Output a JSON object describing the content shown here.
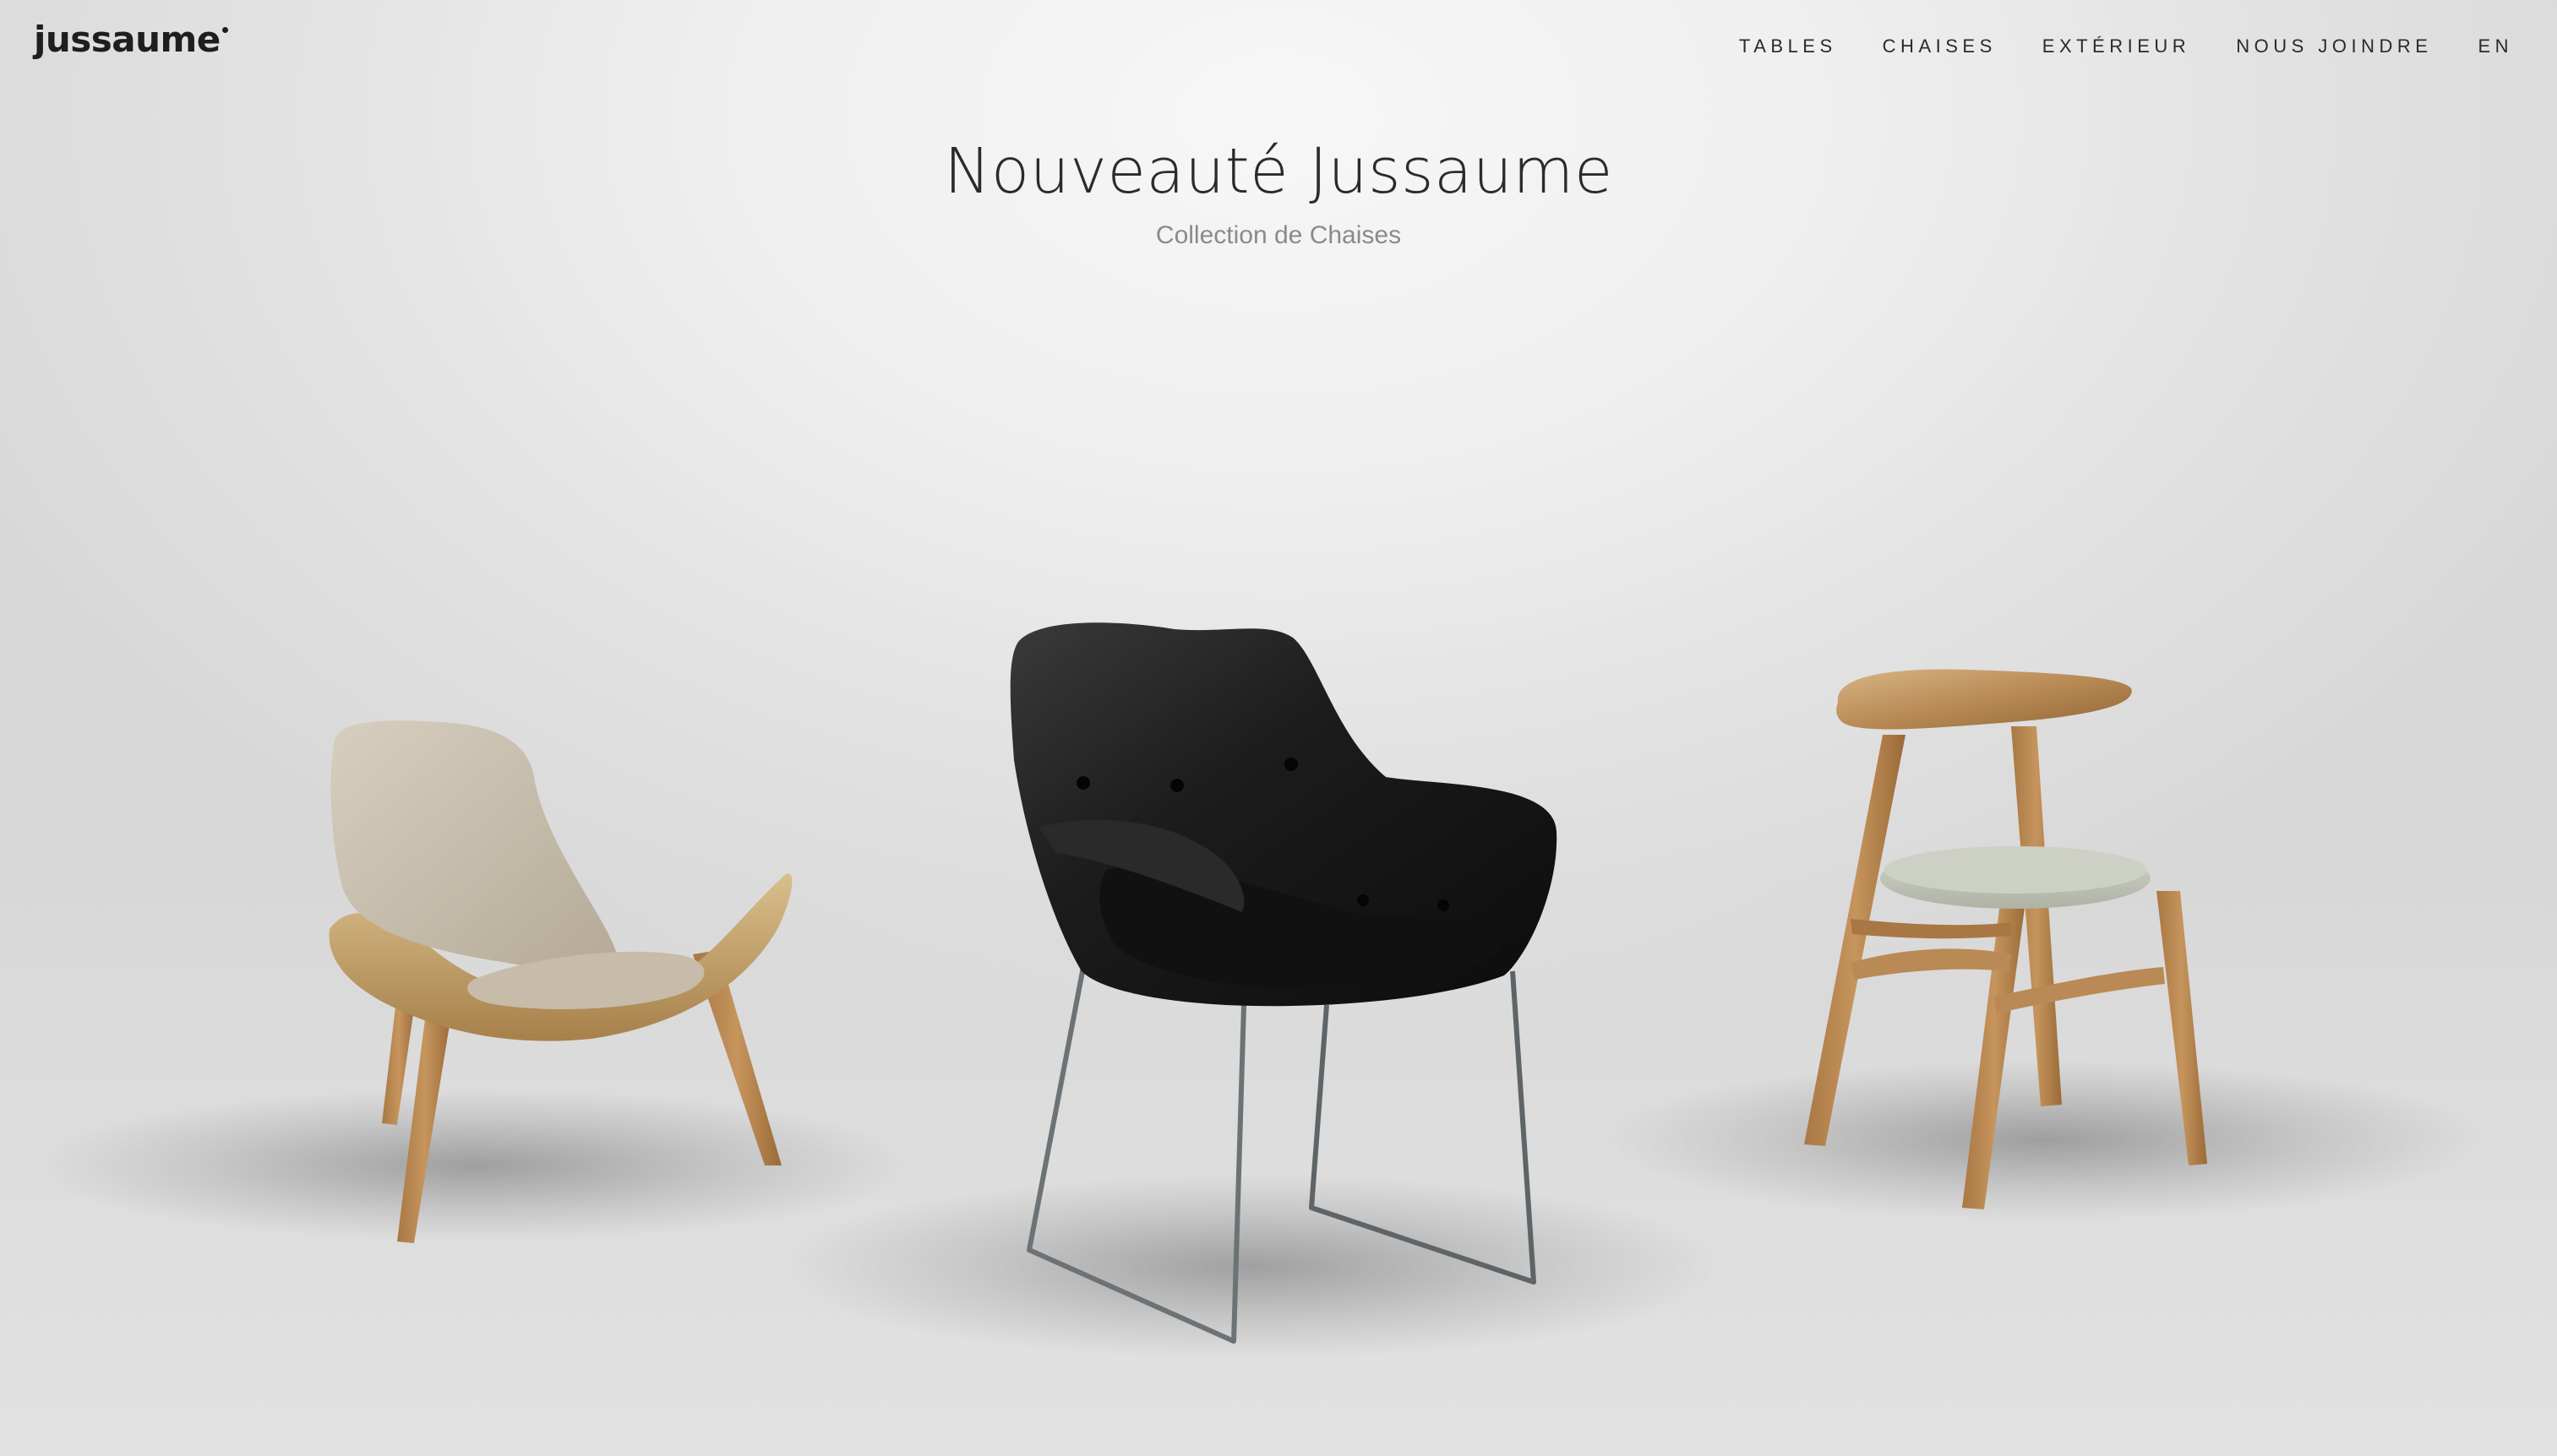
{
  "brand": {
    "logo_text": "jussaume"
  },
  "nav": {
    "items": [
      {
        "label": "TABLES"
      },
      {
        "label": "CHAISES"
      },
      {
        "label": "EXTÉRIEUR"
      },
      {
        "label": "NOUS JOINDRE"
      },
      {
        "label": "EN"
      }
    ]
  },
  "hero": {
    "title": "Nouveauté Jussaume",
    "subtitle": "Collection de Chaises"
  },
  "products": [
    {
      "name": "shell-lounge-chair",
      "material": "oak-fabric"
    },
    {
      "name": "black-leather-armchair",
      "material": "leather-steel"
    },
    {
      "name": "wooden-dining-chair",
      "material": "oak-fabric"
    }
  ],
  "colors": {
    "text_dark": "#2b2b2b",
    "text_muted": "#8a8a8a",
    "background": "#ececec",
    "oak": "#b98a55",
    "leather": "#1a1a1a",
    "steel": "#6c7275",
    "fabric_beige": "#c9bfae",
    "fabric_sage": "#c4c8bb"
  }
}
